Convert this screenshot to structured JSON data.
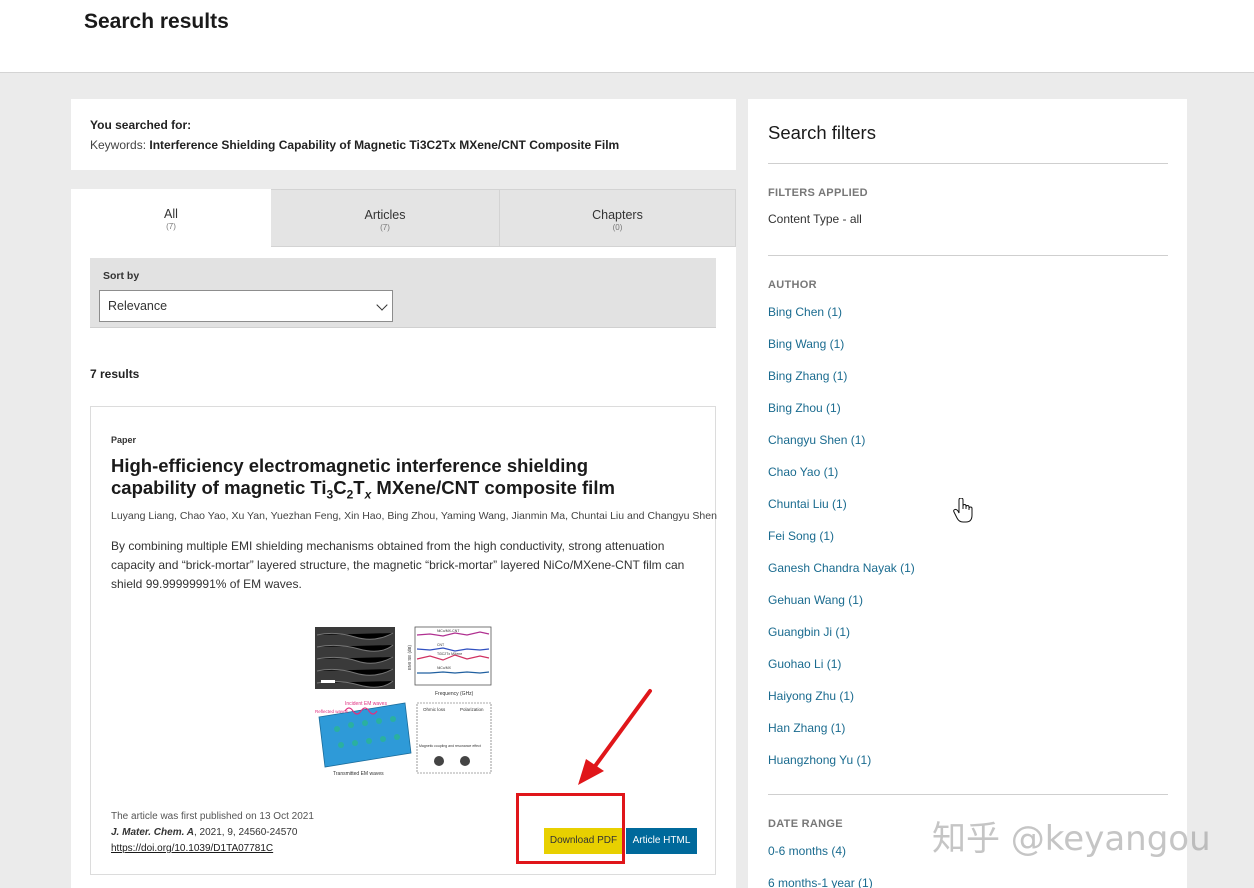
{
  "header": {
    "title": "Search results"
  },
  "searched": {
    "label": "You searched for:",
    "keywords_prefix": "Keywords: ",
    "keywords_value": "Interference Shielding Capability of Magnetic Ti3C2Tx MXene/CNT Composite Film"
  },
  "tabs": [
    {
      "label": "All",
      "count": "(7)"
    },
    {
      "label": "Articles",
      "count": "(7)"
    },
    {
      "label": "Chapters",
      "count": "(0)"
    }
  ],
  "sort": {
    "label": "Sort by",
    "selected": "Relevance"
  },
  "results_count": "7 results",
  "result": {
    "type": "Paper",
    "title_line1": "High-efficiency electromagnetic interference shielding",
    "title_line2_prefix": "capability of magnetic Ti",
    "title_line2_suffix": " MXene/CNT composite film",
    "authors": "Luyang Liang, Chao Yao, Xu Yan, Yuezhan Feng, Xin Hao, Bing Zhou, Yaming Wang, Jianmin Ma, Chuntai Liu and Changyu Shen",
    "abstract": "By combining multiple EMI shielding mechanisms obtained from the high conductivity, strong attenuation capacity and “brick-mortar” layered structure, the magnetic “brick-mortar” layered NiCo/MXene-CNT film can shield 99.99999991% of EM waves.",
    "graphic": {
      "legend_items": [
        "NiCo/MX-CNT",
        "CNT",
        "Ti3C2Tx MXene",
        "NiCo/MX"
      ],
      "x_axis_label": "Frequency (GHz)",
      "y_axis_label": "EMI SE (dB)",
      "label_incident": "Incident EM waves",
      "label_reflected": "Reflected waves",
      "label_transmitted": "Transmitted EM waves",
      "label_ohmic": "Ohmic loss",
      "label_polarization": "Polarization",
      "label_magnetic": "Magnetic coupling and resonance effect"
    },
    "published": "The article was first published on 13 Oct 2021",
    "journal": "J. Mater. Chem. A",
    "citation": ", 2021, 9, 24560-24570",
    "doi": "https://doi.org/10.1039/D1TA07781C",
    "btn_pdf": "Download PDF",
    "btn_html": "Article HTML"
  },
  "filters": {
    "title": "Search filters",
    "applied_label": "FILTERS APPLIED",
    "content_type": "Content Type - all",
    "author_label": "AUTHOR",
    "authors": [
      "Bing Chen (1)",
      "Bing Wang (1)",
      "Bing Zhang (1)",
      "Bing Zhou (1)",
      "Changyu Shen (1)",
      "Chao Yao (1)",
      "Chuntai Liu (1)",
      "Fei Song (1)",
      "Ganesh Chandra Nayak (1)",
      "Gehuan Wang (1)",
      "Guangbin Ji (1)",
      "Guohao Li (1)",
      "Haiyong Zhu (1)",
      "Han Zhang (1)",
      "Huangzhong Yu (1)"
    ],
    "date_label": "DATE RANGE",
    "dates": [
      "0-6 months (4)",
      "6 months-1 year (1)"
    ]
  },
  "watermark": "知乎 @keyangou",
  "colors": {
    "accent_blue": "#00699b",
    "pdf_yellow": "#e8d000",
    "link": "#1a6b8f",
    "annotation_red": "#e0161a"
  }
}
